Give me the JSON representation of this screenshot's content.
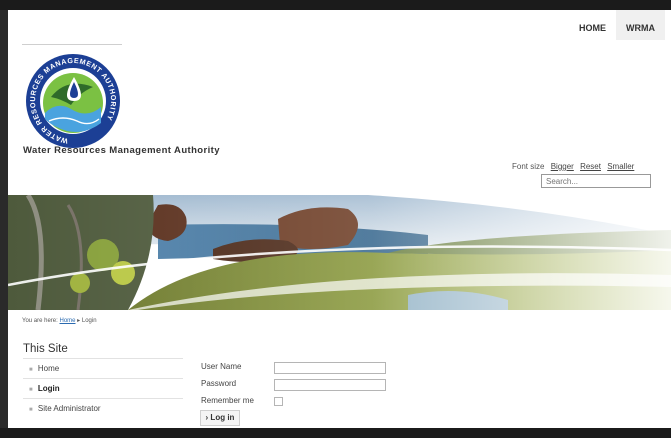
{
  "topnav": {
    "items": [
      "HOME",
      "WRMA"
    ]
  },
  "logo": {
    "ring_text": "WATER RESOURCES MANAGEMENT AUTHORITY",
    "colors": {
      "ring": "#1c3f95",
      "green": "#7bc143",
      "water": "#4aa3df"
    }
  },
  "header": {
    "org_name": "Water Resources Management Authority"
  },
  "font_size": {
    "label": "Font size",
    "bigger": "Bigger",
    "reset": "Reset",
    "smaller": "Smaller"
  },
  "search": {
    "placeholder": "Search..."
  },
  "breadcrumb": {
    "prefix": "You are here:",
    "home": "Home",
    "separator": "▸",
    "current": "Login"
  },
  "sidebar": {
    "title": "This Site",
    "items": [
      {
        "label": "Home"
      },
      {
        "label": "Login"
      },
      {
        "label": "Site Administrator"
      }
    ]
  },
  "login_form": {
    "username_label": "User Name",
    "password_label": "Password",
    "remember_label": "Remember me",
    "button_label": "› Log in"
  }
}
